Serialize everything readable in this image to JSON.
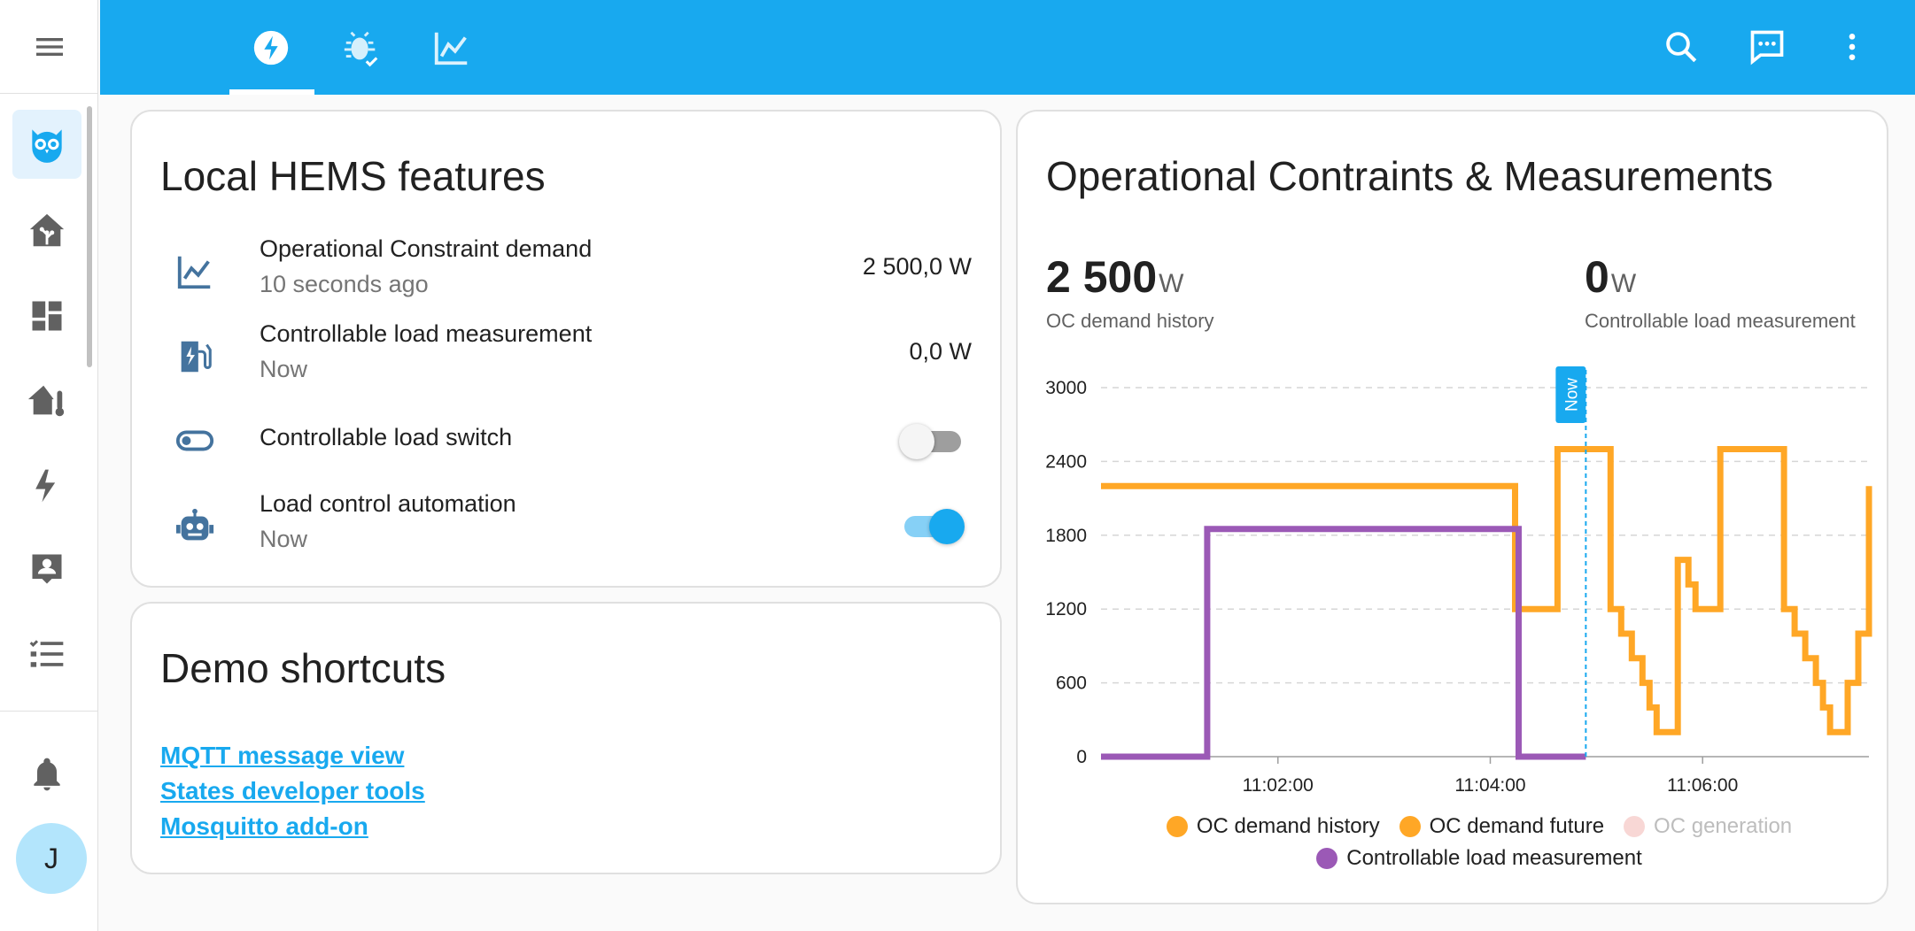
{
  "sidebar": {
    "avatar_initial": "J",
    "items": [
      {
        "icon": "owl-icon"
      },
      {
        "icon": "home-assistant-icon"
      },
      {
        "icon": "dashboard-icon"
      },
      {
        "icon": "home-thermometer-icon"
      },
      {
        "icon": "lightning-icon"
      },
      {
        "icon": "account-box-icon"
      },
      {
        "icon": "format-list-checks-icon"
      }
    ],
    "notification_icon": "bell-icon",
    "accent": "#18a9ef"
  },
  "topbar": {
    "color": "#18a9ef",
    "tabs": [
      {
        "icon": "flash-circle-icon",
        "active": true
      },
      {
        "icon": "bug-check-icon",
        "active": false
      },
      {
        "icon": "chart-line-icon",
        "active": false
      }
    ],
    "actions": [
      "search-icon",
      "assist-chat-icon",
      "more-vertical-icon"
    ]
  },
  "hems_card": {
    "title": "Local HEMS features",
    "rows": [
      {
        "icon": "chart-line-icon",
        "name": "Operational Constraint demand",
        "secondary": "10 seconds ago",
        "value": "2 500,0 W"
      },
      {
        "icon": "ev-station-icon",
        "name": "Controllable load measurement",
        "secondary": "Now",
        "value": "0,0 W"
      },
      {
        "icon": "toggle-switch-icon",
        "name": "Controllable load switch",
        "secondary": "",
        "state": "off"
      },
      {
        "icon": "robot-icon",
        "name": "Load control automation",
        "secondary": "Now",
        "state": "on"
      }
    ]
  },
  "shortcuts_card": {
    "title": "Demo shortcuts",
    "links": [
      "MQTT message view",
      "States developer tools",
      "Mosquitto add-on"
    ]
  },
  "chart_card": {
    "title": "Operational Contraints & Measurements",
    "stats": [
      {
        "value": "2 500",
        "unit": "W",
        "label": "OC demand history"
      },
      {
        "value": "0",
        "unit": "W",
        "label": "Controllable load measurement"
      }
    ],
    "now_label": "Now",
    "legend": [
      {
        "name": "OC demand history",
        "color": "#ffa726",
        "dimmed": false
      },
      {
        "name": "OC demand future",
        "color": "#ffa726",
        "dimmed": false
      },
      {
        "name": "OC generation",
        "color": "#f8d7d5",
        "dimmed": true
      },
      {
        "name": "Controllable load measurement",
        "color": "#9b59b6",
        "dimmed": false
      }
    ]
  },
  "chart_data": {
    "type": "line",
    "step": true,
    "x_unit": "minutes",
    "xlim": [
      "11:00:20",
      "11:07:34"
    ],
    "ylim": [
      0,
      3000
    ],
    "yticks": [
      0,
      600,
      1200,
      1800,
      2400,
      3000
    ],
    "xticks": [
      "11:02:00",
      "11:04:00",
      "11:06:00"
    ],
    "now": "11:04:54",
    "grid": true,
    "series": [
      {
        "name": "OC demand history",
        "color": "#ffa726",
        "points": [
          [
            "11:00:20",
            2200
          ],
          [
            "11:04:14",
            2200
          ],
          [
            "11:04:14",
            1200
          ],
          [
            "11:04:38",
            1200
          ],
          [
            "11:04:38",
            2500
          ],
          [
            "11:04:54",
            2500
          ]
        ]
      },
      {
        "name": "OC demand future",
        "color": "#ffa726",
        "points": [
          [
            "11:04:54",
            2500
          ],
          [
            "11:05:08",
            2500
          ],
          [
            "11:05:08",
            1200
          ],
          [
            "11:05:14",
            1200
          ],
          [
            "11:05:14",
            1000
          ],
          [
            "11:05:20",
            1000
          ],
          [
            "11:05:20",
            800
          ],
          [
            "11:05:26",
            800
          ],
          [
            "11:05:26",
            600
          ],
          [
            "11:05:30",
            600
          ],
          [
            "11:05:30",
            400
          ],
          [
            "11:05:34",
            400
          ],
          [
            "11:05:34",
            200
          ],
          [
            "11:05:46",
            200
          ],
          [
            "11:05:46",
            1600
          ],
          [
            "11:05:52",
            1600
          ],
          [
            "11:05:52",
            1400
          ],
          [
            "11:05:56",
            1400
          ],
          [
            "11:05:56",
            1200
          ],
          [
            "11:06:10",
            1200
          ],
          [
            "11:06:10",
            2500
          ],
          [
            "11:06:46",
            2500
          ],
          [
            "11:06:46",
            1200
          ],
          [
            "11:06:52",
            1200
          ],
          [
            "11:06:52",
            1000
          ],
          [
            "11:06:58",
            1000
          ],
          [
            "11:06:58",
            800
          ],
          [
            "11:07:04",
            800
          ],
          [
            "11:07:04",
            600
          ],
          [
            "11:07:08",
            600
          ],
          [
            "11:07:08",
            400
          ],
          [
            "11:07:12",
            400
          ],
          [
            "11:07:12",
            200
          ],
          [
            "11:07:22",
            200
          ],
          [
            "11:07:22",
            600
          ],
          [
            "11:07:28",
            600
          ],
          [
            "11:07:28",
            1000
          ],
          [
            "11:07:34",
            1000
          ],
          [
            "11:07:34",
            1400
          ],
          [
            "11:07:38",
            1400
          ],
          [
            "11:07:38",
            1800
          ],
          [
            "11:07:42",
            1800
          ],
          [
            "11:07:42",
            2200
          ],
          [
            "11:08:04",
            2200
          ]
        ]
      },
      {
        "name": "OC generation",
        "color": "#f8d7d5",
        "points": []
      },
      {
        "name": "Controllable load measurement",
        "color": "#9b59b6",
        "points": [
          [
            "11:00:20",
            0
          ],
          [
            "11:01:20",
            0
          ],
          [
            "11:01:20",
            1850
          ],
          [
            "11:04:16",
            1850
          ],
          [
            "11:04:16",
            0
          ],
          [
            "11:04:54",
            0
          ]
        ]
      }
    ]
  }
}
